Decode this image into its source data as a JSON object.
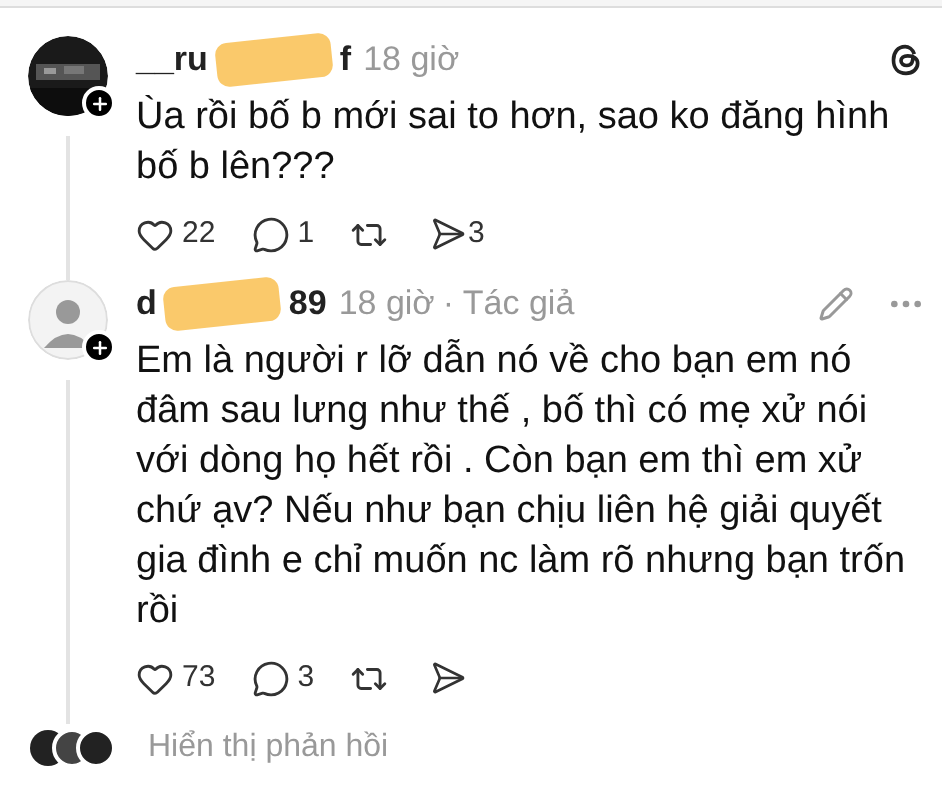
{
  "comments": [
    {
      "username_parts": [
        "__ru",
        "f"
      ],
      "time": "18 giờ",
      "text": "Ùa rồi bố b mới sai to hơn, sao ko đăng hình bố b lên???",
      "likes": "22",
      "replies": "1",
      "shares": "3",
      "is_author": false
    },
    {
      "avatar": {
        "kind": "default"
      },
      "username_parts": [
        "d",
        "89"
      ],
      "time": "18 giờ",
      "author_tag": "· Tác giả",
      "text": "Em là người r lỡ dẫn nó về cho bạn em nó đâm sau lưng như thế , bố thì có mẹ xử nói với dòng họ hết rồi . Còn bạn em thì em xử chứ ạv? Nếu như bạn chịu liên hệ giải quyết gia đình e chỉ muốn nc làm rõ nhưng bạn trốn rồi",
      "likes": "73",
      "replies": "3",
      "is_author": true
    }
  ],
  "more_replies": "Hiển thị phản hồi"
}
